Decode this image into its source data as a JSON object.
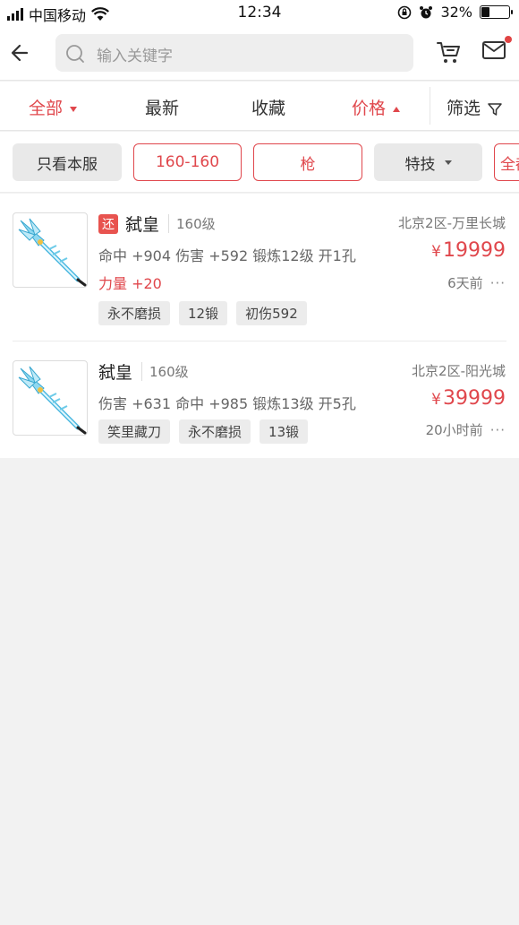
{
  "status": {
    "carrier": "中国移动",
    "time": "12:34",
    "battery": "32%"
  },
  "search": {
    "placeholder": "输入关键字"
  },
  "tabs": [
    {
      "label": "全部"
    },
    {
      "label": "最新"
    },
    {
      "label": "收藏"
    },
    {
      "label": "价格"
    },
    {
      "label": "筛选"
    }
  ],
  "filters": [
    {
      "label": "只看本服"
    },
    {
      "label": "160-160"
    },
    {
      "label": "枪"
    },
    {
      "label": "特技"
    },
    {
      "label": "全都"
    }
  ],
  "items": [
    {
      "badge": "还",
      "name": "弑皇",
      "level": "160级",
      "attrs": "命中 +904 伤害 +592 锻炼12级 开1孔",
      "bonus": "力量 +20",
      "tags": [
        "永不磨损",
        "12锻",
        "初伤592"
      ],
      "server": "北京2区-万里长城",
      "currency": "¥",
      "price": "19999",
      "time": "6天前",
      "more": "···"
    },
    {
      "name": "弑皇",
      "level": "160级",
      "attrs": "伤害 +631 命中 +985 锻炼13级 开5孔",
      "tags": [
        "笑里藏刀",
        "永不磨损",
        "13锻"
      ],
      "server": "北京2区-阳光城",
      "currency": "¥",
      "price": "39999",
      "time": "20小时前",
      "more": "···"
    }
  ],
  "colors": {
    "accent": "#e0474c",
    "badge": "#e8534f"
  }
}
